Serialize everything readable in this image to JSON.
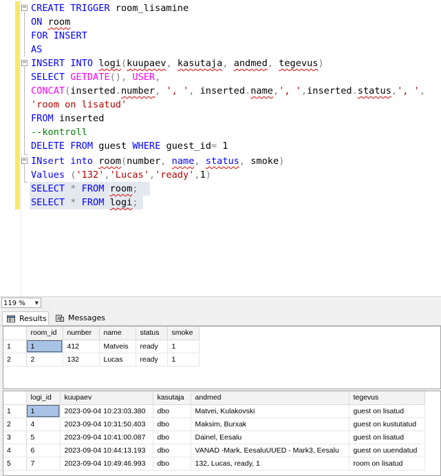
{
  "editor": {
    "lines": [
      "CREATE TRIGGER room_lisamine",
      "ON room",
      "FOR INSERT",
      "AS",
      "INSERT INTO logi(kuupaev, kasutaja, andmed, tegevus)",
      "SELECT GETDATE(), USER,",
      "CONCAT(inserted.number, ', ', inserted.name,', ',inserted.status,', ',",
      "'room on lisatud'",
      "FROM inserted",
      "--kontroll",
      "DELETE FROM guest WHERE guest_id= 1",
      "INsert into room(number, name, status, smoke)",
      "Values ('132','Lucas','ready',1)",
      "SELECT * FROM room;",
      "SELECT * FROM logi;"
    ]
  },
  "zoom": {
    "value": "119 %"
  },
  "tabs": {
    "results": "Results",
    "messages": "Messages"
  },
  "grid1": {
    "columns": [
      "room_id",
      "number",
      "name",
      "status",
      "smoke"
    ],
    "rows": [
      [
        "1",
        "1",
        "412",
        "Matveis",
        "ready",
        "1"
      ],
      [
        "2",
        "2",
        "132",
        "Lucas",
        "ready",
        "1"
      ]
    ]
  },
  "grid2": {
    "columns": [
      "logi_id",
      "kuupaev",
      "kasutaja",
      "andmed",
      "tegevus"
    ],
    "rows": [
      [
        "1",
        "1",
        "2023-09-04 10:23:03.380",
        "dbo",
        "Matvei, Kulakovski",
        "guest on lisatud"
      ],
      [
        "2",
        "4",
        "2023-09-04 10:31:50.403",
        "dbo",
        "Maksim, Burxak",
        "guest on kustutatud"
      ],
      [
        "3",
        "5",
        "2023-09-04 10:41:00.087",
        "dbo",
        "Dainel, Eesalu",
        "guest on lisatud"
      ],
      [
        "4",
        "6",
        "2023-09-04 10:44:13.193",
        "dbo",
        "VANAD -Mark, EesaluUUED - Mark3, Eesalu",
        "guest on uuendatud"
      ],
      [
        "5",
        "7",
        "2023-09-04 10:49:46.993",
        "dbo",
        "132, Lucas, ready, 1",
        "room on lisatud"
      ]
    ]
  }
}
